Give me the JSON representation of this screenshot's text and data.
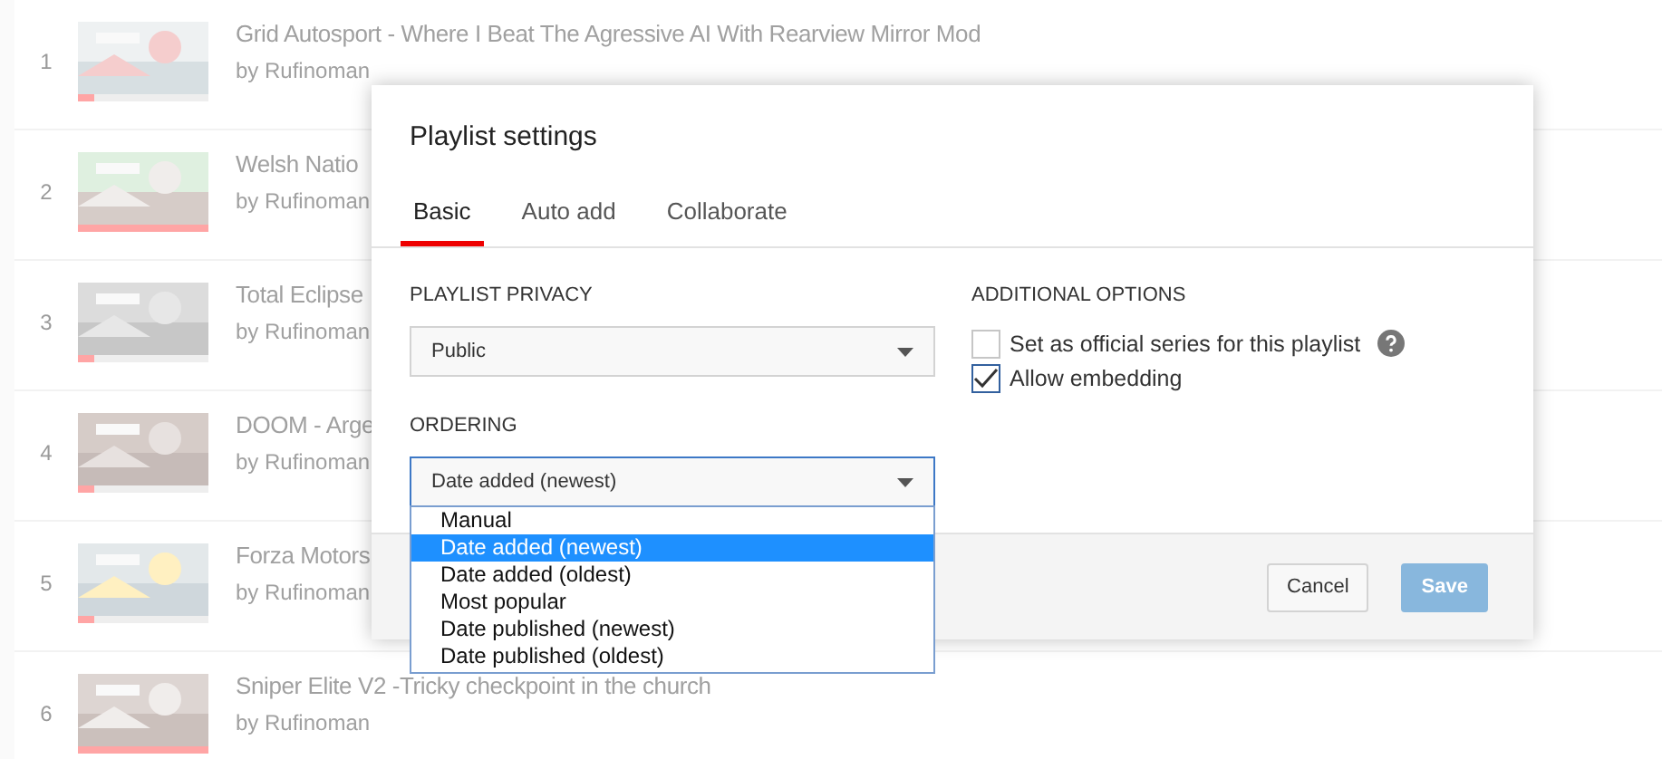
{
  "videos": [
    {
      "index": "1",
      "title": "Grid Autosport - Where I Beat The Agressive AI With Rearview Mirror Mod",
      "channel": "by Rufinoman",
      "level": 0.12
    },
    {
      "index": "2",
      "title": "Welsh Natio",
      "channel": "by Rufinoman",
      "level": 1
    },
    {
      "index": "3",
      "title": "Total Eclipse",
      "channel": "by Rufinoman",
      "level": 0.12
    },
    {
      "index": "4",
      "title": "DOOM - Arge",
      "channel": "by Rufinoman",
      "level": 0.12
    },
    {
      "index": "5",
      "title": "Forza Motors",
      "channel": "by Rufinoman",
      "level": 0.12
    },
    {
      "index": "6",
      "title": "Sniper Elite V2 -Tricky checkpoint in the church",
      "channel": "by Rufinoman",
      "level": 1
    }
  ],
  "dialog": {
    "title": "Playlist settings",
    "tabs": [
      {
        "label": "Basic",
        "selected": true
      },
      {
        "label": "Auto add",
        "selected": false
      },
      {
        "label": "Collaborate",
        "selected": false
      }
    ],
    "privacy": {
      "label": "PLAYLIST PRIVACY",
      "value": "Public"
    },
    "ordering": {
      "label": "ORDERING",
      "value": "Date added (newest)",
      "expanded": true,
      "options": [
        {
          "label": "Manual",
          "selected": false
        },
        {
          "label": "Date added (newest)",
          "selected": true
        },
        {
          "label": "Date added (oldest)",
          "selected": false
        },
        {
          "label": "Most popular",
          "selected": false
        },
        {
          "label": "Date published (newest)",
          "selected": false
        },
        {
          "label": "Date published (oldest)",
          "selected": false
        }
      ]
    },
    "additional": {
      "label": "ADDITIONAL OPTIONS",
      "options": [
        {
          "label": "Set as official series for this playlist",
          "checked": false,
          "help": true
        },
        {
          "label": "Allow embedding",
          "checked": true
        }
      ]
    },
    "buttons": [
      {
        "label": "Cancel",
        "kind": "secondary",
        "disabled": false
      },
      {
        "label": "Save",
        "kind": "primary",
        "disabled": true
      }
    ]
  }
}
